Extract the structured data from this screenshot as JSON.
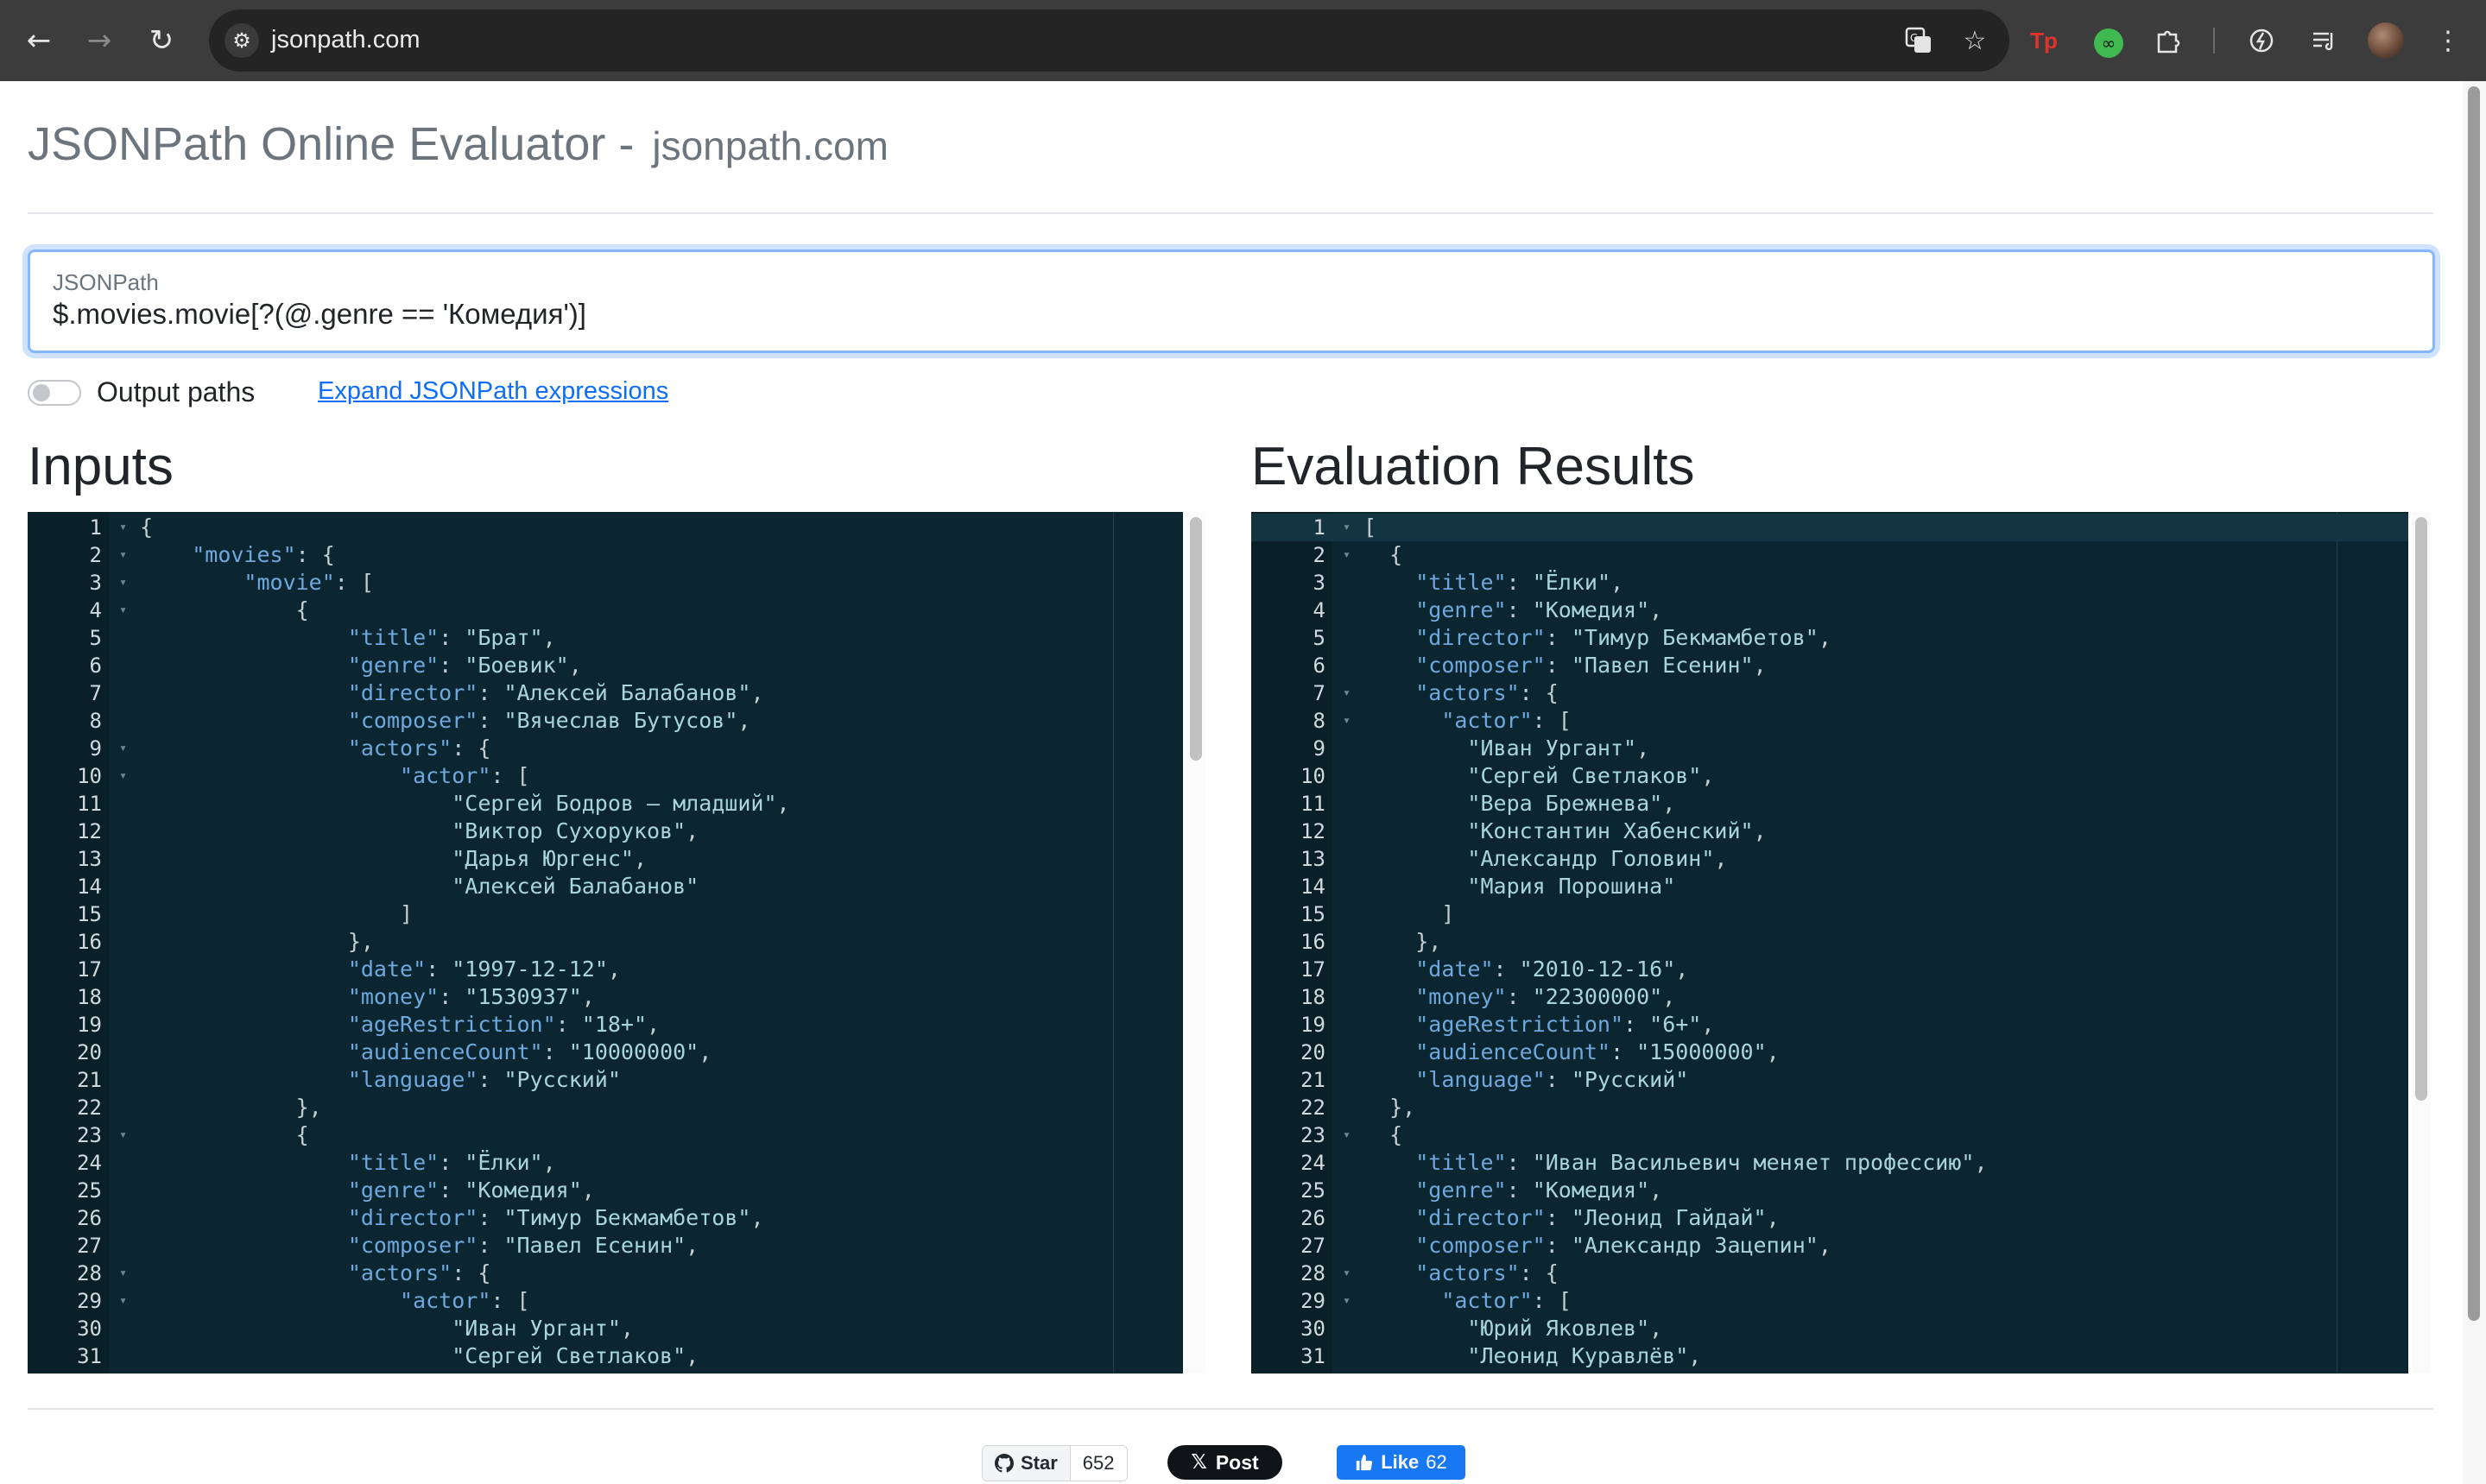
{
  "browser": {
    "url": "jsonpath.com",
    "back_icon": "←",
    "forward_icon": "→",
    "reload_icon": "↻"
  },
  "header": {
    "title": "JSONPath Online Evaluator",
    "separator": " - ",
    "subtitle": "jsonpath.com"
  },
  "jsonpath": {
    "label": "JSONPath",
    "value": "$.movies.movie[?(@.genre == 'Комедия')]"
  },
  "options": {
    "output_paths_label": "Output paths",
    "output_paths_enabled": false,
    "expand_link": "Expand JSONPath expressions"
  },
  "inputs": {
    "heading": "Inputs",
    "lines": [
      {
        "n": "1",
        "fold": true,
        "text": "{"
      },
      {
        "n": "2",
        "fold": true,
        "text": "    \"movies\": {"
      },
      {
        "n": "3",
        "fold": true,
        "text": "        \"movie\": ["
      },
      {
        "n": "4",
        "fold": true,
        "text": "            {"
      },
      {
        "n": "5",
        "fold": false,
        "text": "                \"title\": \"Брат\","
      },
      {
        "n": "6",
        "fold": false,
        "text": "                \"genre\": \"Боевик\","
      },
      {
        "n": "7",
        "fold": false,
        "text": "                \"director\": \"Алексей Балабанов\","
      },
      {
        "n": "8",
        "fold": false,
        "text": "                \"composer\": \"Вячеслав Бутусов\","
      },
      {
        "n": "9",
        "fold": true,
        "text": "                \"actors\": {"
      },
      {
        "n": "10",
        "fold": true,
        "text": "                    \"actor\": ["
      },
      {
        "n": "11",
        "fold": false,
        "text": "                        \"Сергей Бодров – младший\","
      },
      {
        "n": "12",
        "fold": false,
        "text": "                        \"Виктор Сухоруков\","
      },
      {
        "n": "13",
        "fold": false,
        "text": "                        \"Дарья Юргенс\","
      },
      {
        "n": "14",
        "fold": false,
        "text": "                        \"Алексей Балабанов\""
      },
      {
        "n": "15",
        "fold": false,
        "text": "                    ]"
      },
      {
        "n": "16",
        "fold": false,
        "text": "                },"
      },
      {
        "n": "17",
        "fold": false,
        "text": "                \"date\": \"1997-12-12\","
      },
      {
        "n": "18",
        "fold": false,
        "text": "                \"money\": \"1530937\","
      },
      {
        "n": "19",
        "fold": false,
        "text": "                \"ageRestriction\": \"18+\","
      },
      {
        "n": "20",
        "fold": false,
        "text": "                \"audienceCount\": \"10000000\","
      },
      {
        "n": "21",
        "fold": false,
        "text": "                \"language\": \"Русский\""
      },
      {
        "n": "22",
        "fold": false,
        "text": "            },"
      },
      {
        "n": "23",
        "fold": true,
        "text": "            {"
      },
      {
        "n": "24",
        "fold": false,
        "text": "                \"title\": \"Ёлки\","
      },
      {
        "n": "25",
        "fold": false,
        "text": "                \"genre\": \"Комедия\","
      },
      {
        "n": "26",
        "fold": false,
        "text": "                \"director\": \"Тимур Бекмамбетов\","
      },
      {
        "n": "27",
        "fold": false,
        "text": "                \"composer\": \"Павел Есенин\","
      },
      {
        "n": "28",
        "fold": true,
        "text": "                \"actors\": {"
      },
      {
        "n": "29",
        "fold": true,
        "text": "                    \"actor\": ["
      },
      {
        "n": "30",
        "fold": false,
        "text": "                        \"Иван Ургант\","
      },
      {
        "n": "31",
        "fold": false,
        "text": "                        \"Сергей Светлаков\","
      }
    ]
  },
  "results": {
    "heading": "Evaluation Results",
    "lines": [
      {
        "n": "1",
        "fold": true,
        "text": "["
      },
      {
        "n": "2",
        "fold": true,
        "text": "  {"
      },
      {
        "n": "3",
        "fold": false,
        "text": "    \"title\": \"Ёлки\","
      },
      {
        "n": "4",
        "fold": false,
        "text": "    \"genre\": \"Комедия\","
      },
      {
        "n": "5",
        "fold": false,
        "text": "    \"director\": \"Тимур Бекмамбетов\","
      },
      {
        "n": "6",
        "fold": false,
        "text": "    \"composer\": \"Павел Есенин\","
      },
      {
        "n": "7",
        "fold": true,
        "text": "    \"actors\": {"
      },
      {
        "n": "8",
        "fold": true,
        "text": "      \"actor\": ["
      },
      {
        "n": "9",
        "fold": false,
        "text": "        \"Иван Ургант\","
      },
      {
        "n": "10",
        "fold": false,
        "text": "        \"Сергей Светлаков\","
      },
      {
        "n": "11",
        "fold": false,
        "text": "        \"Вера Брежнева\","
      },
      {
        "n": "12",
        "fold": false,
        "text": "        \"Константин Хабенский\","
      },
      {
        "n": "13",
        "fold": false,
        "text": "        \"Александр Головин\","
      },
      {
        "n": "14",
        "fold": false,
        "text": "        \"Мария Порошина\""
      },
      {
        "n": "15",
        "fold": false,
        "text": "      ]"
      },
      {
        "n": "16",
        "fold": false,
        "text": "    },"
      },
      {
        "n": "17",
        "fold": false,
        "text": "    \"date\": \"2010-12-16\","
      },
      {
        "n": "18",
        "fold": false,
        "text": "    \"money\": \"22300000\","
      },
      {
        "n": "19",
        "fold": false,
        "text": "    \"ageRestriction\": \"6+\","
      },
      {
        "n": "20",
        "fold": false,
        "text": "    \"audienceCount\": \"15000000\","
      },
      {
        "n": "21",
        "fold": false,
        "text": "    \"language\": \"Русский\""
      },
      {
        "n": "22",
        "fold": false,
        "text": "  },"
      },
      {
        "n": "23",
        "fold": true,
        "text": "  {"
      },
      {
        "n": "24",
        "fold": false,
        "text": "    \"title\": \"Иван Васильевич меняет профессию\","
      },
      {
        "n": "25",
        "fold": false,
        "text": "    \"genre\": \"Комедия\","
      },
      {
        "n": "26",
        "fold": false,
        "text": "    \"director\": \"Леонид Гайдай\","
      },
      {
        "n": "27",
        "fold": false,
        "text": "    \"composer\": \"Александр Зацепин\","
      },
      {
        "n": "28",
        "fold": true,
        "text": "    \"actors\": {"
      },
      {
        "n": "29",
        "fold": true,
        "text": "      \"actor\": ["
      },
      {
        "n": "30",
        "fold": false,
        "text": "        \"Юрий Яковлев\","
      },
      {
        "n": "31",
        "fold": false,
        "text": "        \"Леонид Куравлёв\","
      }
    ]
  },
  "footer": {
    "github_star_label": "Star",
    "github_star_count": "652",
    "x_post_label": "Post",
    "fb_like_label": "Like",
    "fb_like_count": "62"
  },
  "colors": {
    "editor_bg": "#0c2631",
    "editor_key": "#6fa8dc",
    "editor_string": "#a8d4dd",
    "link": "#0d6efd",
    "fb_blue": "#1877f2"
  }
}
